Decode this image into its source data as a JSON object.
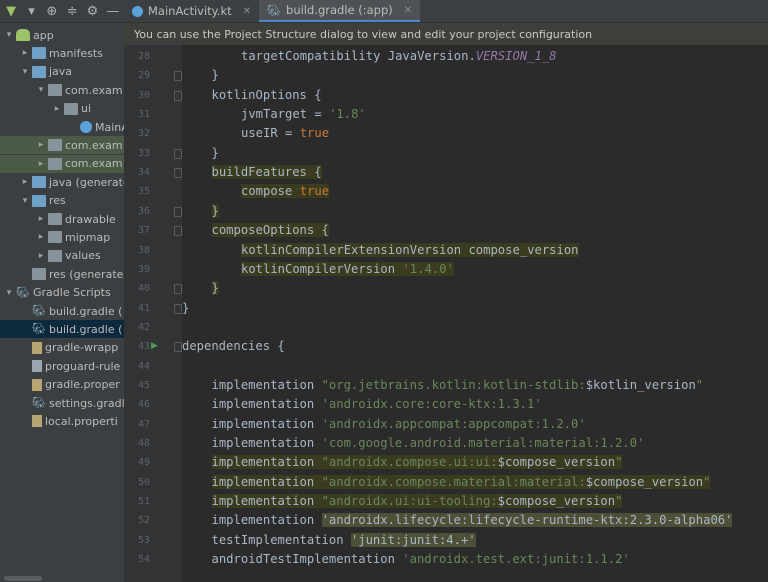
{
  "window": {
    "accent": "#4a88c7",
    "bg": "#2b2b2b"
  },
  "toolbar": {
    "icons": [
      "android-icon",
      "dropdown-icon",
      "target-icon",
      "collapse-icon",
      "gear-icon",
      "minimize-icon"
    ]
  },
  "tabs": [
    {
      "label": "MainActivity.kt",
      "icon": "kotlin-icon",
      "active": false
    },
    {
      "label": "build.gradle (:app)",
      "icon": "gradle-icon",
      "active": true
    }
  ],
  "banner": "You can use the Project Structure dialog to view and edit your project configuration",
  "tree": [
    {
      "label": "app",
      "depth": 0,
      "arrow": "▾",
      "icon": "android-icon"
    },
    {
      "label": "manifests",
      "depth": 1,
      "arrow": "▸",
      "icon": "folder-icon"
    },
    {
      "label": "java",
      "depth": 1,
      "arrow": "▾",
      "icon": "folder-icon"
    },
    {
      "label": "com.exam",
      "depth": 2,
      "arrow": "▾",
      "icon": "package-icon"
    },
    {
      "label": "ui",
      "depth": 3,
      "arrow": "▸",
      "icon": "package-icon"
    },
    {
      "label": "MainA",
      "depth": 4,
      "arrow": "",
      "icon": "kotlin-icon"
    },
    {
      "label": "com.exam",
      "depth": 2,
      "arrow": "▸",
      "icon": "package-icon",
      "highlight": true
    },
    {
      "label": "com.exam",
      "depth": 2,
      "arrow": "▸",
      "icon": "package-icon",
      "highlight": true
    },
    {
      "label": "java (generate",
      "depth": 1,
      "arrow": "▸",
      "icon": "folder-icon"
    },
    {
      "label": "res",
      "depth": 1,
      "arrow": "▾",
      "icon": "folder-icon"
    },
    {
      "label": "drawable",
      "depth": 2,
      "arrow": "▸",
      "icon": "folder-icon"
    },
    {
      "label": "mipmap",
      "depth": 2,
      "arrow": "▸",
      "icon": "folder-icon"
    },
    {
      "label": "values",
      "depth": 2,
      "arrow": "▸",
      "icon": "folder-icon"
    },
    {
      "label": "res (generates",
      "depth": 1,
      "arrow": "",
      "icon": "folder-icon"
    },
    {
      "label": "Gradle Scripts",
      "depth": 0,
      "arrow": "▾",
      "icon": "gradle-icon"
    },
    {
      "label": "build.gradle (",
      "depth": 1,
      "arrow": "",
      "icon": "gradle-icon"
    },
    {
      "label": "build.gradle (",
      "depth": 1,
      "arrow": "",
      "icon": "gradle-icon",
      "selected": true
    },
    {
      "label": "gradle-wrapp",
      "depth": 1,
      "arrow": "",
      "icon": "properties-icon"
    },
    {
      "label": "proguard-rule",
      "depth": 1,
      "arrow": "",
      "icon": "file-icon"
    },
    {
      "label": "gradle.proper",
      "depth": 1,
      "arrow": "",
      "icon": "properties-icon"
    },
    {
      "label": "settings.gradle",
      "depth": 1,
      "arrow": "",
      "icon": "gradle-icon"
    },
    {
      "label": "local.properti",
      "depth": 1,
      "arrow": "",
      "icon": "properties-icon"
    }
  ],
  "code": [
    {
      "n": "28",
      "indent": 2,
      "tokens": [
        [
          "plain",
          "targetCompatibility JavaVersion."
        ],
        [
          "const",
          "VERSION_1_8"
        ]
      ]
    },
    {
      "n": "29",
      "indent": 1,
      "tokens": [
        [
          "plain",
          "}"
        ]
      ]
    },
    {
      "n": "30",
      "indent": 1,
      "tokens": [
        [
          "plain",
          "kotlinOptions {"
        ]
      ]
    },
    {
      "n": "31",
      "indent": 2,
      "tokens": [
        [
          "plain",
          "jvmTarget = "
        ],
        [
          "str",
          "'1.8'"
        ]
      ]
    },
    {
      "n": "32",
      "indent": 2,
      "tokens": [
        [
          "plain",
          "useIR = "
        ],
        [
          "kw",
          "true"
        ]
      ]
    },
    {
      "n": "33",
      "indent": 1,
      "tokens": [
        [
          "plain",
          "}"
        ]
      ]
    },
    {
      "n": "34",
      "indent": 1,
      "hl": true,
      "tokens": [
        [
          "kwp",
          "buildFeatures {"
        ]
      ]
    },
    {
      "n": "35",
      "indent": 2,
      "hl": true,
      "tokens": [
        [
          "plain",
          "compose "
        ],
        [
          "kw",
          "true"
        ]
      ]
    },
    {
      "n": "36",
      "indent": 1,
      "hl": true,
      "tokens": [
        [
          "plain",
          "}"
        ]
      ]
    },
    {
      "n": "37",
      "indent": 1,
      "hl": true,
      "tokens": [
        [
          "plain",
          "composeOptions {"
        ]
      ]
    },
    {
      "n": "38",
      "indent": 2,
      "hl": true,
      "tokens": [
        [
          "plain",
          "kotlinCompilerExtensionVersion compose_version"
        ]
      ]
    },
    {
      "n": "39",
      "indent": 2,
      "hl": true,
      "tokens": [
        [
          "plain",
          "kotlinCompilerVersion "
        ],
        [
          "str",
          "'1.4.0'"
        ]
      ]
    },
    {
      "n": "40",
      "indent": 1,
      "hl": true,
      "tokens": [
        [
          "plain",
          "}"
        ]
      ]
    },
    {
      "n": "41",
      "indent": 0,
      "tokens": [
        [
          "plain",
          "}"
        ]
      ]
    },
    {
      "n": "42",
      "indent": 0,
      "tokens": []
    },
    {
      "n": "43",
      "indent": 0,
      "run": true,
      "tokens": [
        [
          "plain",
          "dependencies {"
        ]
      ]
    },
    {
      "n": "44",
      "indent": 0,
      "tokens": []
    },
    {
      "n": "45",
      "indent": 1,
      "tokens": [
        [
          "plain",
          "implementation "
        ],
        [
          "str",
          "\"org.jetbrains.kotlin:kotlin-stdlib:"
        ],
        [
          "plain",
          "$kotlin_version"
        ],
        [
          "str",
          "\""
        ]
      ]
    },
    {
      "n": "46",
      "indent": 1,
      "tokens": [
        [
          "plain",
          "implementation "
        ],
        [
          "str",
          "'androidx.core:core-ktx:1.3.1'"
        ]
      ]
    },
    {
      "n": "47",
      "indent": 1,
      "tokens": [
        [
          "plain",
          "implementation "
        ],
        [
          "str",
          "'androidx.appcompat:appcompat:1.2.0'"
        ]
      ]
    },
    {
      "n": "48",
      "indent": 1,
      "tokens": [
        [
          "plain",
          "implementation "
        ],
        [
          "str",
          "'com.google.android.material:material:1.2.0'"
        ]
      ]
    },
    {
      "n": "49",
      "indent": 1,
      "hl": true,
      "tokens": [
        [
          "plain",
          "implementation "
        ],
        [
          "str",
          "\"androidx.compose.ui:ui:"
        ],
        [
          "plain",
          "$compose_version"
        ],
        [
          "str",
          "\""
        ]
      ]
    },
    {
      "n": "50",
      "indent": 1,
      "hl": true,
      "tokens": [
        [
          "plain",
          "implementation "
        ],
        [
          "str",
          "\"androidx.compose.material:material:"
        ],
        [
          "plain",
          "$compose_version"
        ],
        [
          "str",
          "\""
        ]
      ]
    },
    {
      "n": "51",
      "indent": 1,
      "hl": true,
      "tokens": [
        [
          "plain",
          "implementation "
        ],
        [
          "str",
          "\"androidx.ui:ui-tooling:"
        ],
        [
          "plain",
          "$compose_version"
        ],
        [
          "str",
          "\""
        ]
      ]
    },
    {
      "n": "52",
      "indent": 1,
      "tokens": [
        [
          "plain",
          "implementation "
        ],
        [
          "warn",
          "'androidx.lifecycle:lifecycle-runtime-ktx:2.3.0-alpha06'"
        ]
      ]
    },
    {
      "n": "53",
      "indent": 1,
      "tokens": [
        [
          "plain",
          "testImplementation "
        ],
        [
          "warn",
          "'junit:junit:4.+'"
        ]
      ]
    },
    {
      "n": "54",
      "indent": 1,
      "tokens": [
        [
          "plain",
          "androidTestImplementation "
        ],
        [
          "str",
          "'androidx.test.ext:junit:1.1.2'"
        ]
      ]
    }
  ]
}
